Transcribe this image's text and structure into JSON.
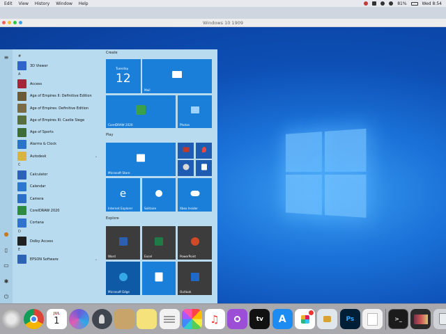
{
  "menubar": {
    "items": [
      "Edit",
      "View",
      "History",
      "Window",
      "Help"
    ],
    "battery": "81%",
    "clock": "Wed 8:54"
  },
  "window": {
    "title": "Windows 10 1909"
  },
  "start_menu": {
    "apps": [
      {
        "type": "letter",
        "text": "#"
      },
      {
        "type": "app",
        "label": "3D Viewer",
        "color": "#2f66c8"
      },
      {
        "type": "letter",
        "text": "A"
      },
      {
        "type": "app",
        "label": "Access",
        "color": "#a3263a"
      },
      {
        "type": "app",
        "label": "Age of Empires II: Definitive Edition",
        "color": "#6b5a3a"
      },
      {
        "type": "app",
        "label": "Age of Empires: Definitive Edition",
        "color": "#7a6b47"
      },
      {
        "type": "app",
        "label": "Age of Empires III: Castle Siege",
        "color": "#587040"
      },
      {
        "type": "app",
        "label": "Age of Sports",
        "color": "#3d6e3a"
      },
      {
        "type": "app",
        "label": "Alarms & Clock",
        "color": "#2b73c6"
      },
      {
        "type": "app",
        "label": "Autodesk",
        "color": "#d7b545",
        "chevron": true
      },
      {
        "type": "letter",
        "text": "C"
      },
      {
        "type": "app",
        "label": "Calculator",
        "color": "#2e62b8"
      },
      {
        "type": "app",
        "label": "Calendar",
        "color": "#2c78d0"
      },
      {
        "type": "app",
        "label": "Camera",
        "color": "#2d6fc4"
      },
      {
        "type": "app",
        "label": "CorelDRAW 2020",
        "color": "#2e8b42"
      },
      {
        "type": "app",
        "label": "Cortana",
        "color": "#2f74cc"
      },
      {
        "type": "letter",
        "text": "D"
      },
      {
        "type": "app",
        "label": "Dolby Access",
        "color": "#202020"
      },
      {
        "type": "letter",
        "text": "E"
      },
      {
        "type": "app",
        "label": "EPSON Software",
        "color": "#2d63b4",
        "chevron": true
      }
    ],
    "groups": [
      "Create",
      "Play",
      "Explore"
    ],
    "tiles": {
      "calendar_day": "Tuesday",
      "calendar_date": "12",
      "mail": "Mail",
      "coreldraw": "CorelDRAW 2020",
      "photos": "Photos",
      "store": "Microsoft Store",
      "ie": "Internet Explorer",
      "solitaire": "Solitaire",
      "xbox": "Xbox Insider",
      "word": "Word",
      "excel": "Excel",
      "powerpoint": "PowerPoint",
      "edge": "Microsoft Edge",
      "onenote": "",
      "outlook": "Outlook"
    }
  },
  "dock": {
    "calendar_month": "JUL",
    "calendar_day": "1",
    "tv_label": "tv",
    "ps_label": "Ps"
  }
}
